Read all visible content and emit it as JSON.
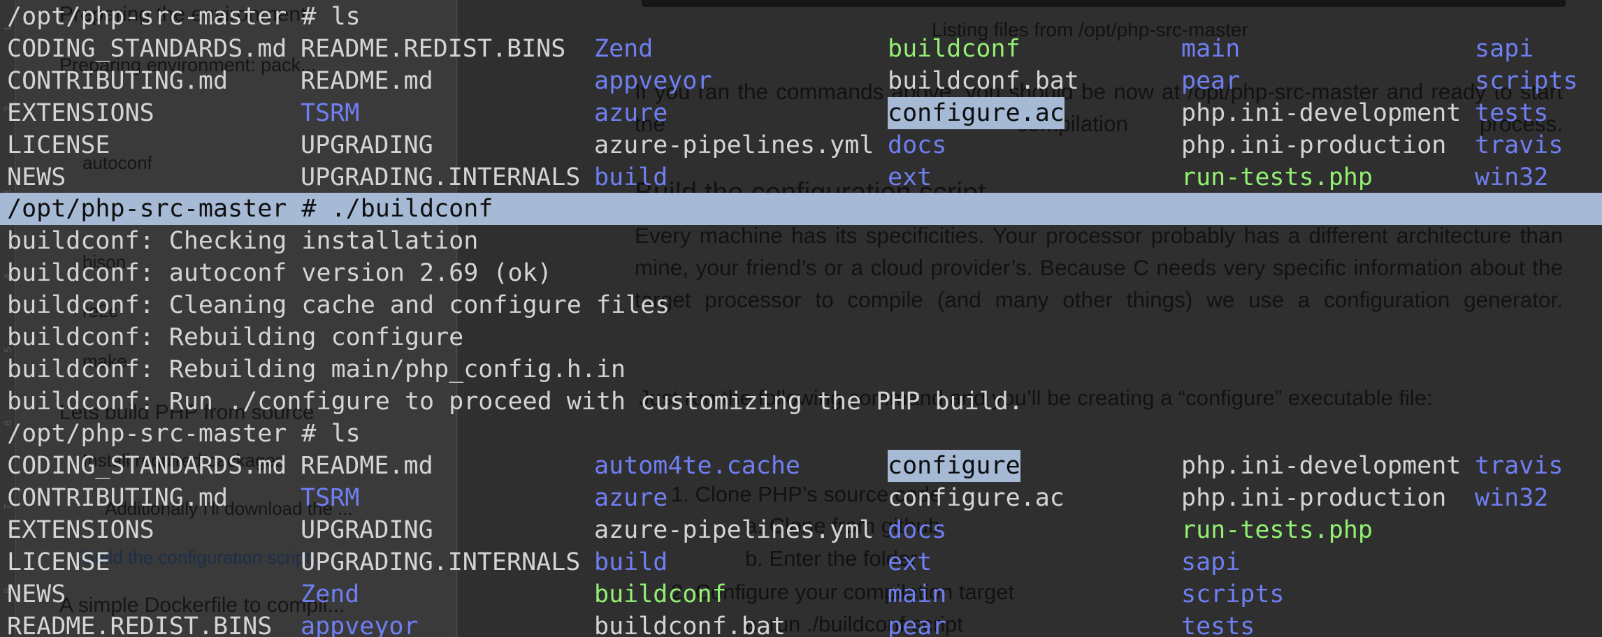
{
  "ghost_document": {
    "ruler_numbers": [
      "1",
      "2",
      "3",
      "4",
      "5",
      "6",
      "7",
      "8"
    ],
    "sidebar": {
      "prep_heading": "Preparing the environment",
      "prep_env": "Preparing environment: pack...",
      "autoconf": "autoconf",
      "bison": "bison",
      "re2c": "re2c",
      "make": "make",
      "lets_build": "Lets build PHP from source",
      "install_packages": "Install required packages",
      "additionally": "Additionally I'll download the ...",
      "build_config_link": "Build the configuration script",
      "dockerfile": "A simple Dockerfile to compil..."
    },
    "main": {
      "caption": "Listing files from /opt/php-src-master",
      "para1": "If you ran the commands above, you should be now at /opt/php-src-master and ready to start the compilation process.",
      "h2": "Build the configuration script",
      "para2": "Every machine has its specificities. Your processor probably has a different architecture than mine, your friend’s or a cloud provider’s. Because C needs very specific information about the target processor to compile (and many other things) we use a configuration generator.",
      "para3": "Just run the following command and you’ll be creating a “configure” executable file:",
      "list_1": "1.   Clone PHP’s source code",
      "list_1a": "a.   Clone from github",
      "list_1b": "b.   Enter the folder",
      "list_2": "2.   Configure your compilation target",
      "list_2a": "a.   run ./buildconf script"
    }
  },
  "terminal": {
    "prompt_ls_1": "/opt/php-src-master # ls",
    "listing_1": [
      [
        {
          "t": "CODING_STANDARDS.md",
          "c": "plain"
        },
        {
          "t": "README.REDIST.BINS",
          "c": "plain"
        },
        {
          "t": "Zend",
          "c": "blue"
        },
        {
          "t": "buildconf",
          "c": "green"
        },
        {
          "t": "main",
          "c": "blue"
        },
        {
          "t": "sapi",
          "c": "blue"
        }
      ],
      [
        {
          "t": "CONTRIBUTING.md",
          "c": "plain"
        },
        {
          "t": "README.md",
          "c": "plain"
        },
        {
          "t": "appveyor",
          "c": "blue"
        },
        {
          "t": "buildconf.bat",
          "c": "plain"
        },
        {
          "t": "pear",
          "c": "blue"
        },
        {
          "t": "scripts",
          "c": "blue"
        }
      ],
      [
        {
          "t": "EXTENSIONS",
          "c": "plain"
        },
        {
          "t": "TSRM",
          "c": "blue"
        },
        {
          "t": "azure",
          "c": "blue"
        },
        {
          "t": "configure.ac",
          "c": "sel"
        },
        {
          "t": "php.ini-development",
          "c": "plain"
        },
        {
          "t": "tests",
          "c": "blue"
        }
      ],
      [
        {
          "t": "LICENSE",
          "c": "plain"
        },
        {
          "t": "UPGRADING",
          "c": "plain"
        },
        {
          "t": "azure-pipelines.yml",
          "c": "plain"
        },
        {
          "t": "docs",
          "c": "blue"
        },
        {
          "t": "php.ini-production",
          "c": "plain"
        },
        {
          "t": "travis",
          "c": "blue"
        }
      ],
      [
        {
          "t": "NEWS",
          "c": "plain"
        },
        {
          "t": "UPGRADING.INTERNALS",
          "c": "plain"
        },
        {
          "t": "build",
          "c": "blue"
        },
        {
          "t": "ext",
          "c": "blue"
        },
        {
          "t": "run-tests.php",
          "c": "green"
        },
        {
          "t": "win32",
          "c": "blue"
        }
      ]
    ],
    "prompt_buildconf": "/opt/php-src-master # ./buildconf",
    "buildconf_output": [
      "buildconf: Checking installation",
      "buildconf: autoconf version 2.69 (ok)",
      "buildconf: Cleaning cache and configure files",
      "buildconf: Rebuilding configure",
      "buildconf: Rebuilding main/php_config.h.in",
      "buildconf: Run ./configure to proceed with customizing the PHP build."
    ],
    "prompt_ls_2": "/opt/php-src-master # ls",
    "listing_2": [
      [
        {
          "t": "CODING_STANDARDS.md",
          "c": "plain"
        },
        {
          "t": "README.md",
          "c": "plain"
        },
        {
          "t": "autom4te.cache",
          "c": "blue"
        },
        {
          "t": "configure",
          "c": "sel"
        },
        {
          "t": "php.ini-development",
          "c": "plain"
        },
        {
          "t": "travis",
          "c": "blue"
        }
      ],
      [
        {
          "t": "CONTRIBUTING.md",
          "c": "plain"
        },
        {
          "t": "TSRM",
          "c": "blue"
        },
        {
          "t": "azure",
          "c": "blue"
        },
        {
          "t": "configure.ac",
          "c": "plain"
        },
        {
          "t": "php.ini-production",
          "c": "plain"
        },
        {
          "t": "win32",
          "c": "blue"
        }
      ],
      [
        {
          "t": "EXTENSIONS",
          "c": "plain"
        },
        {
          "t": "UPGRADING",
          "c": "plain"
        },
        {
          "t": "azure-pipelines.yml",
          "c": "plain"
        },
        {
          "t": "docs",
          "c": "blue"
        },
        {
          "t": "run-tests.php",
          "c": "green"
        },
        {
          "t": "",
          "c": "plain"
        }
      ],
      [
        {
          "t": "LICENSE",
          "c": "plain"
        },
        {
          "t": "UPGRADING.INTERNALS",
          "c": "plain"
        },
        {
          "t": "build",
          "c": "blue"
        },
        {
          "t": "ext",
          "c": "blue"
        },
        {
          "t": "sapi",
          "c": "blue"
        },
        {
          "t": "",
          "c": "plain"
        }
      ],
      [
        {
          "t": "NEWS",
          "c": "plain"
        },
        {
          "t": "Zend",
          "c": "blue"
        },
        {
          "t": "buildconf",
          "c": "green"
        },
        {
          "t": "main",
          "c": "blue"
        },
        {
          "t": "scripts",
          "c": "blue"
        },
        {
          "t": "",
          "c": "plain"
        }
      ],
      [
        {
          "t": "README.REDIST.BINS",
          "c": "plain"
        },
        {
          "t": "appveyor",
          "c": "blue"
        },
        {
          "t": "buildconf.bat",
          "c": "plain"
        },
        {
          "t": "pear",
          "c": "blue"
        },
        {
          "t": "tests",
          "c": "blue"
        },
        {
          "t": "",
          "c": "plain"
        }
      ]
    ],
    "colors": {
      "background": "#2f2f2f",
      "text": "#d4d4d4",
      "directory": "#6f7ff2",
      "executable": "#92ef72",
      "selection": "#a6b9d5"
    }
  }
}
